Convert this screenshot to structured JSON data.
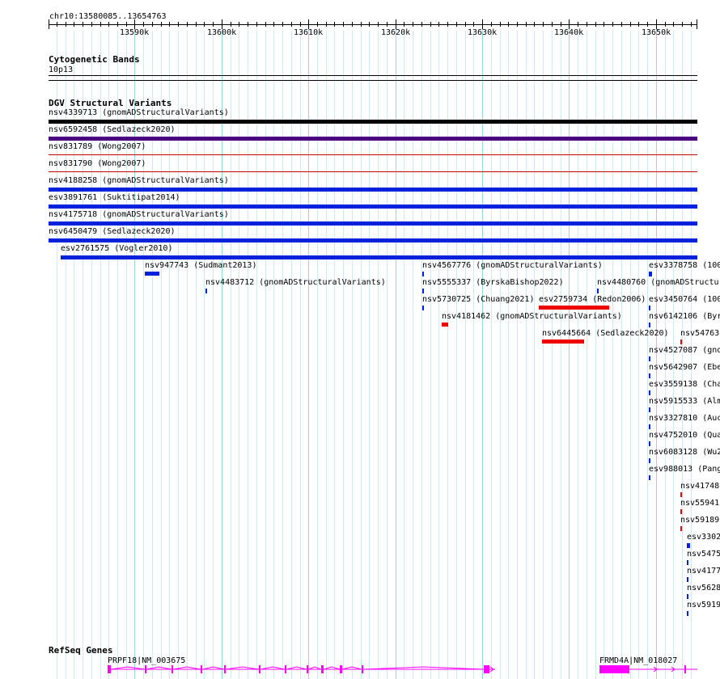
{
  "ruler": {
    "location": "chr10:13580085..13654763",
    "ticks": [
      "13590k",
      "13600k",
      "13610k",
      "13620k",
      "13630k",
      "13640k",
      "13650k"
    ]
  },
  "cytobands": {
    "title": "Cytogenetic Bands",
    "band": "10p13"
  },
  "dgv": {
    "title": "DGV Structural Variants",
    "variants": [
      {
        "label": "nsv4339713 (gnomADStructuralVariants)",
        "color": "#000000",
        "kind": "full"
      },
      {
        "label": "nsv6592458 (Sedlazeck2020)",
        "color": "#4a0080",
        "kind": "full"
      },
      {
        "label": "nsv831789 (Wong2007)",
        "color": "#c00000",
        "kind": "thin"
      },
      {
        "label": "nsv831790 (Wong2007)",
        "color": "#c00000",
        "kind": "thin"
      },
      {
        "label": "nsv4188258 (gnomADStructuralVariants)",
        "color": "#0022dd",
        "kind": "full"
      },
      {
        "label": "esv3891761 (Suktitipat2014)",
        "color": "#0022dd",
        "kind": "full"
      },
      {
        "label": "nsv4175718 (gnomADStructuralVariants)",
        "color": "#0022dd",
        "kind": "full"
      },
      {
        "label": "nsv6450479 (Sedlazeck2020)",
        "color": "#0022dd",
        "kind": "full"
      },
      {
        "label": "esv2761575 (Vogler2010)",
        "color": "#0022dd",
        "kind": "full"
      },
      {
        "label": "nsv947743 (Sudmant2013)",
        "color": "#0022dd",
        "kind": "short"
      },
      {
        "label": "nsv4483712 (gnomADStructuralVariants)",
        "color": "#0022dd",
        "kind": "short"
      },
      {
        "label": "nsv4567776 (gnomADStructuralVariants)",
        "color": "#0022dd",
        "kind": "short"
      },
      {
        "label": "nsv5555337 (ByrskaBishop2022)",
        "color": "#0022dd",
        "kind": "short"
      },
      {
        "label": "nsv5730725 (Chuang2021)",
        "color": "#0022dd",
        "kind": "short"
      },
      {
        "label": "nsv4181462 (gnomADStructuralVariants)",
        "color": "#ee0000",
        "kind": "short"
      },
      {
        "label": "esv2759734 (Redon2006)",
        "color": "#ee0000",
        "kind": "short"
      },
      {
        "label": "nsv4480760 (gnomADStructur",
        "color": "#0022dd",
        "kind": "short"
      },
      {
        "label": "nsv6445664 (Sedlazeck2020)",
        "color": "#ee0000",
        "kind": "short"
      },
      {
        "label": "esv3378758 (100",
        "color": "#0022dd",
        "kind": "short"
      },
      {
        "label": "esv3450764 (100",
        "color": "#0022dd",
        "kind": "short"
      },
      {
        "label": "nsv6142106 (Byr",
        "color": "#0022dd",
        "kind": "short"
      },
      {
        "label": "nsv54763",
        "color": "#ee0000",
        "kind": "short"
      },
      {
        "label": "nsv4527087 (gno",
        "color": "#0022dd",
        "kind": "short"
      },
      {
        "label": "nsv5642907 (Ebe",
        "color": "#0022dd",
        "kind": "short"
      },
      {
        "label": "esv3559138 (Cha",
        "color": "#0022dd",
        "kind": "short"
      },
      {
        "label": "nsv5915533 (Alm",
        "color": "#0022dd",
        "kind": "short"
      },
      {
        "label": "nsv3327810 (Auc",
        "color": "#0022dd",
        "kind": "short"
      },
      {
        "label": "nsv4752010 (Qua",
        "color": "#0022dd",
        "kind": "short"
      },
      {
        "label": "nsv6083128 (Wu2",
        "color": "#0022dd",
        "kind": "short"
      },
      {
        "label": "esv988013 (Pang",
        "color": "#0022dd",
        "kind": "short"
      },
      {
        "label": "nsv41748",
        "color": "#ee0000",
        "kind": "short"
      },
      {
        "label": "nsv55941",
        "color": "#ee0000",
        "kind": "short"
      },
      {
        "label": "nsv59189",
        "color": "#ee0000",
        "kind": "short"
      },
      {
        "label": "esv3302",
        "color": "#0022dd",
        "kind": "short"
      },
      {
        "label": "nsv5475",
        "color": "#0022dd",
        "kind": "short"
      },
      {
        "label": "nsv4177",
        "color": "#0022dd",
        "kind": "short"
      },
      {
        "label": "nsv5628",
        "color": "#0022dd",
        "kind": "short"
      },
      {
        "label": "nsv5919",
        "color": "#0022dd",
        "kind": "short"
      }
    ]
  },
  "refseq": {
    "title": "RefSeq Genes",
    "genes": [
      {
        "label": "PRPF18|NM_003675",
        "color": "#ff00ff"
      },
      {
        "label": "FRMD4A|NM_018027",
        "color": "#ff00ff"
      }
    ]
  }
}
